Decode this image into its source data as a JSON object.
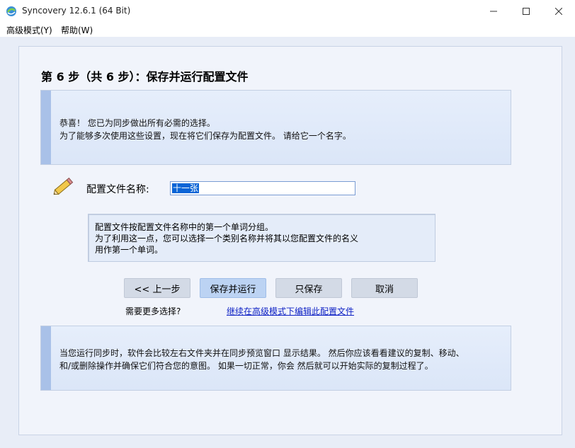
{
  "window": {
    "title": "Syncovery 12.6.1 (64 Bit)"
  },
  "menu": {
    "items": [
      "高级模式(Y)",
      "帮助(W)"
    ]
  },
  "step": {
    "title": "第 6 步（共 6 步）：保存并运行配置文件"
  },
  "intro_panel": {
    "line1": "恭喜！ 您已为同步做出所有必需的选择。",
    "line2": "为了能够多次使用这些设置，现在将它们保存为配置文件。 请给它一个名字。"
  },
  "profile_name": {
    "label": "配置文件名称:",
    "value": "十一张"
  },
  "note": {
    "line1": "配置文件按配置文件名称中的第一个单词分组。",
    "line2": "为了利用这一点，您可以选择一个类别名称并将其以您配置文件的名义",
    "line3": "用作第一个单词。"
  },
  "buttons": {
    "back": "<< 上一步",
    "save_run": "保存并运行",
    "save_only": "只保存",
    "cancel": "取消"
  },
  "more_options": {
    "label": "需要更多选择?",
    "link": "继续在高级模式下编辑此配置文件"
  },
  "info_panel": {
    "line1": "当您运行同步时，软件会比较左右文件夹并在同步预览窗口 显示结果。 然后你应该看看建议的复制、移动、",
    "line2": "和/或删除操作并确保它们符合您的意图。 如果一切正常，你会 然后就可以开始实际的复制过程了。"
  }
}
